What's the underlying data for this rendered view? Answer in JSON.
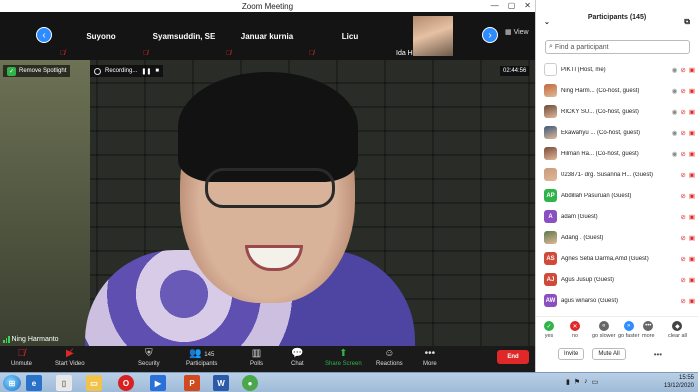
{
  "window": {
    "title": "Zoom Meeting",
    "controls": [
      "—",
      "▢",
      "✕"
    ]
  },
  "strip": {
    "prev_icon": "‹",
    "next_icon": "›",
    "thumbnails": [
      {
        "name": "Suyono"
      },
      {
        "name": "Syamsuddin, SE"
      },
      {
        "name": "Januar kurnia"
      },
      {
        "name": "Licu"
      }
    ],
    "photo_thumb_name": "Ida H",
    "view_label": "View"
  },
  "video": {
    "spotlight_label": "Remove Spotlight",
    "recording_label": "Recording...",
    "timer": "02:44:56",
    "speaker_name": "Ning Harmanto"
  },
  "toolbar": {
    "unmute": "Unmute",
    "start_video": "Start Video",
    "security": "Security",
    "participants": "Participants",
    "participants_count": "145",
    "polls": "Polls",
    "chat": "Chat",
    "share_screen": "Share Screen",
    "reactions": "Reactions",
    "more": "More",
    "end": "End"
  },
  "panel": {
    "title": "Participants (145)",
    "search_placeholder": "Find a participant",
    "participants": [
      {
        "name": "PIKTI (Host, me)",
        "initials": "",
        "color": "#ffffff"
      },
      {
        "name": "Ning Harm... (Co-host, guest)",
        "initials": "",
        "color": "#c06a3a"
      },
      {
        "name": "RICKY SU... (Co-host, guest)",
        "initials": "",
        "color": "#6a4a3a"
      },
      {
        "name": "Ekawahyu ... (Co-host, guest)",
        "initials": "",
        "color": "#3a5a7a"
      },
      {
        "name": "Hilman Ra... (Co-host, guest)",
        "initials": "",
        "color": "#7a4a3a"
      },
      {
        "name": "023871- drg. Susanna H... (Guest)",
        "initials": "",
        "color": "#c89a7a"
      },
      {
        "name": "Abdillah Pasuruan (Guest)",
        "initials": "AP",
        "color": "#2fb34a"
      },
      {
        "name": "adam (Guest)",
        "initials": "A",
        "color": "#8a4fc0"
      },
      {
        "name": "Adang . (Guest)",
        "initials": "",
        "color": "#5a7a4a"
      },
      {
        "name": "Agnes Setia Darma,Amd (Guest)",
        "initials": "AS",
        "color": "#d04a3a"
      },
      {
        "name": "Agus Jusup (Guest)",
        "initials": "AJ",
        "color": "#d04a3a"
      },
      {
        "name": "agus winarso (Guest)",
        "initials": "AW",
        "color": "#8a4fc0"
      }
    ],
    "reactions": [
      {
        "label": "yes",
        "symbol": "✓",
        "color": "#2fb34a"
      },
      {
        "label": "no",
        "symbol": "✕",
        "color": "#e02828"
      },
      {
        "label": "go slower",
        "symbol": "«",
        "color": "#666666"
      },
      {
        "label": "go faster",
        "symbol": "»",
        "color": "#2d8cff"
      },
      {
        "label": "more",
        "symbol": "•••",
        "color": "#666666"
      },
      {
        "label": "clear all",
        "symbol": "◆",
        "color": "#444444"
      }
    ],
    "invite": "Invite",
    "mute_all": "Mute All",
    "more_icon": "•••"
  },
  "taskbar": {
    "time": "15:55",
    "date": "13/12/2020"
  }
}
